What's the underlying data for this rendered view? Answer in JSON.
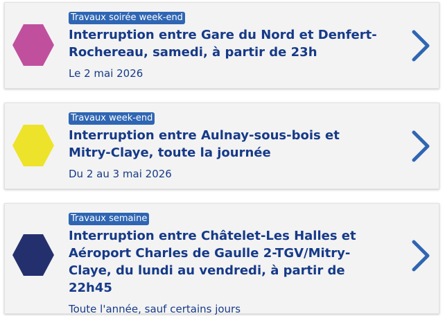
{
  "items": [
    {
      "badge": "Travaux soirée week-end",
      "title": "Interruption entre Gare du Nord et Denfert-Rochereau, samedi, à partir de 23h",
      "date": "Le 2 mai 2026",
      "color": "#c0509e"
    },
    {
      "badge": "Travaux week-end",
      "title": "Interruption entre Aulnay-sous-bois et Mitry-Claye, toute la journée",
      "date": "Du 2 au 3 mai 2026",
      "color": "#ede32a"
    },
    {
      "badge": "Travaux semaine",
      "title": "Interruption entre Châtelet-Les Halles et Aéroport Charles de Gaulle 2-TGV/Mitry-Claye, du lundi au vendredi, à partir de 22h45",
      "date": "Toute l'année, sauf certains jours",
      "color": "#24306e"
    }
  ],
  "chevron_color": "#2f66b3"
}
